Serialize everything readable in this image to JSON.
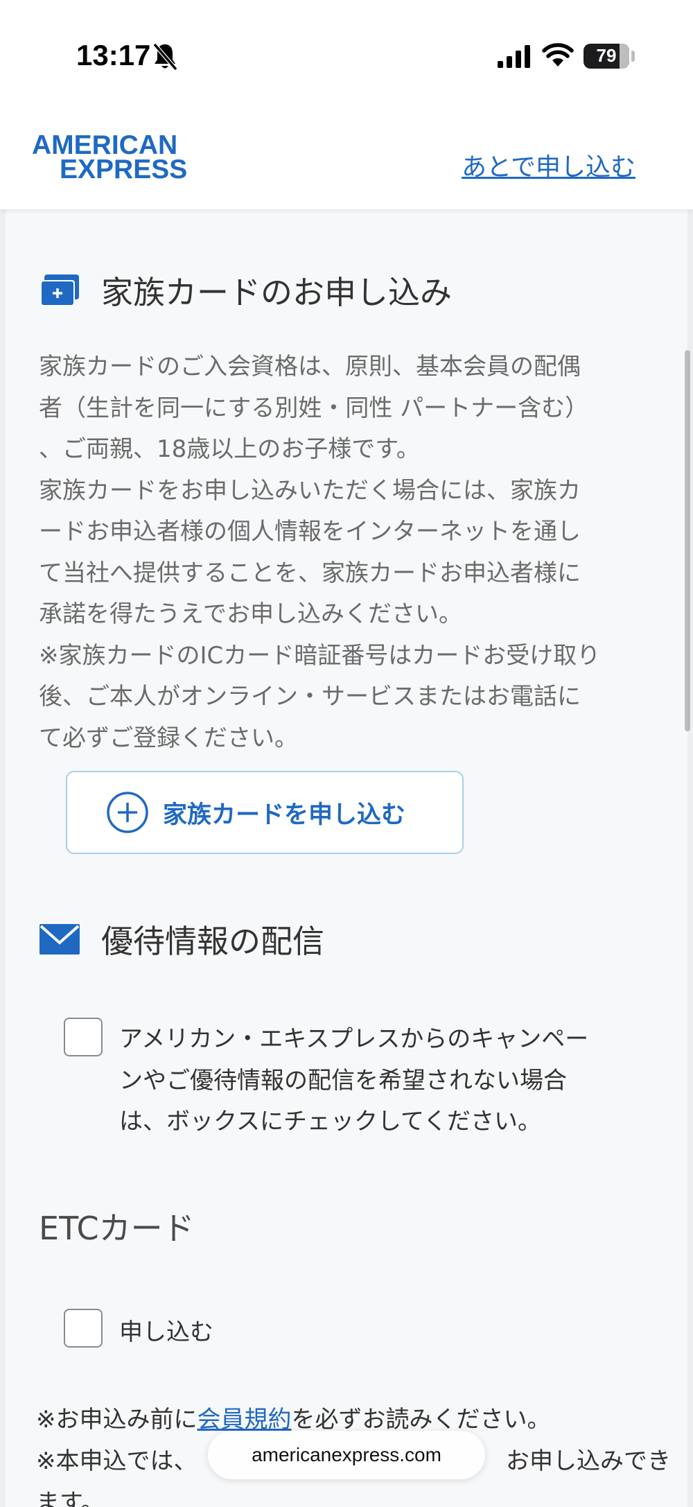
{
  "status_bar": {
    "time": "13:17",
    "battery": "79",
    "battery_level_percent": 79,
    "icons": [
      "bell-slash-icon",
      "cellular-signal-icon",
      "wifi-icon",
      "battery-icon"
    ]
  },
  "header": {
    "logo_line1": "AMERICAN",
    "logo_line2": "EXPRESS",
    "apply_later": "あとで申し込む"
  },
  "family_card": {
    "icon": "credit-card-plus-icon",
    "title": "家族カードのお申し込み",
    "paragraph": "家族カードのご入会資格は、原則、基本会員の配偶\n者（生計を同一にする別姓・同性 パートナー含む）\n、ご両親、18歳以上のお子様です。\n家族カードをお申し込みいただく場合には、家族カ\nードお申込者様の個人情報をインターネットを通し\nて当社へ提供することを、家族カードお申込者様に\n承諾を得たうえでお申し込みください。\n※家族カードのICカード暗証番号はカードお受け取り\n後、ご本人がオンライン・サービスまたはお電話に\nて必ずご登録ください。",
    "button_label": "家族カードを申し込む"
  },
  "promotions": {
    "icon": "envelope-icon",
    "title": "優待情報の配信",
    "checkbox_label": "アメリカン・エキスプレスからのキャンペー\nンやご優待情報の配信を希望されない場合\nは、ボックスにチェックしてください。",
    "checked": false
  },
  "etc_card": {
    "title": "ETCカード",
    "checkbox_label": "申し込む",
    "checked": false
  },
  "notes": {
    "line1_prefix": "※お申込み前に",
    "terms_link": "会員規約",
    "line1_suffix": "を必ずお読みください。",
    "line2_start": "※本申込では、",
    "line2_end": "お申し込みでき",
    "line3": "ます。"
  },
  "url_bar": {
    "url": "americanexpress.com"
  },
  "colors": {
    "brand_blue": "#1f69c3",
    "body_text": "#6b6b6b",
    "background": "#f7f8f9"
  }
}
